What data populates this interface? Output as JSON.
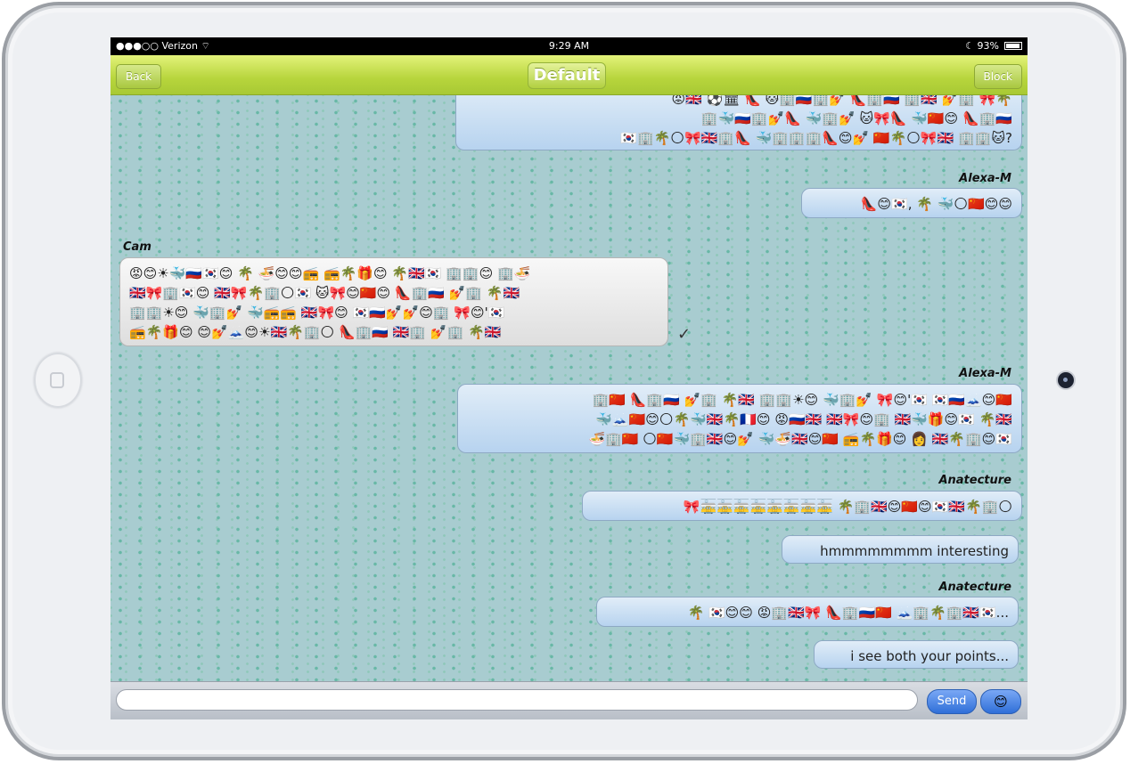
{
  "status_bar": {
    "carrier": "●●●○○ Verizon ⌔",
    "time": "9:29 AM",
    "battery": "☾ 93%"
  },
  "nav": {
    "back_label": "Back",
    "title": "Default",
    "block_label": "Block"
  },
  "messages": [
    {
      "id": "m1",
      "sender": "",
      "side": "right",
      "text": "😡🇬🇧 ⚽🏛 👠 🐱🏢🇷🇺🏢💅 👠🏢🇷🇺 🏢🇬🇧 💅🏢 🎀🌴\n🏢🐳🇷🇺🏢💅👠 🐳🏢💅 🐱🎀👠 🐳🇨🇳😊 👠🏢🇷🇺\n🇰🇷🏢🌴🌕🎀🇬🇧🏢👠 🐳🏢🏢🏢👠😊💅 🇨🇳🌴🌕🎀🇬🇧 🏢🏢🐱?"
    },
    {
      "id": "m2",
      "sender": "Alexa-M",
      "side": "right",
      "text": "👠😊🇰🇷, 🌴 🐳🌕🇨🇳😊😊"
    },
    {
      "id": "m3",
      "sender": "Cam",
      "side": "left",
      "text": "😡😊☀🐳🇷🇺🇰🇷😊 🌴 🍜😊😊📻 📻🌴🎁😊 🌴🇬🇧🇰🇷 🏢🏢😊 🏢🍜\n🇬🇧🎀🏢🇰🇷😊 🇬🇧🎀🌴🏢🌕🇰🇷 🐱🎀😊🇨🇳😊 👠🏢🇷🇺 💅🏢 🌴🇬🇧\n🏢🏢☀😊 🐳🏢💅 🐳📻📻 🇬🇧🎀😊 🇰🇷🇷🇺💅💅😊🏢 🎀😊'🇰🇷\n📻🌴🎁😊 😊💅🗻😊☀🇬🇧🌴🏢🌕 👠🏢🇷🇺 🇬🇧🏢 💅🏢 🌴🇬🇧"
    },
    {
      "id": "m4",
      "sender": "Alexa-M",
      "side": "right",
      "text": "🏢🇨🇳 👠🏢🇷🇺 💅🏢 🌴🇬🇧 🏢🏢☀😊 🐳🏢💅 🎀😊'🇰🇷 🇰🇷🇷🇺🗻😊🇨🇳\n🐳🗻🇨🇳😊🌕🌴🐳🇬🇧🌴🇫🇷😊 😡🇷🇺🇬🇧 🇬🇧🎀😊🏢 🇬🇧🐳🎁😊🇰🇷 🌴🇬🇧\n🍜🏢🇨🇳 🌕🇨🇳🐳🏢🇬🇧😊💅 🐳🍜🇬🇧😊🇨🇳 📻🌴🎁😊 👩 🇬🇧🌴🏢😊🇰🇷"
    },
    {
      "id": "m5",
      "sender": "Anatecture",
      "side": "right",
      "text": "🎀🚋🚋🚋🚋🚋🚋🚋🚋 🌴🏢🇬🇧😊🇨🇳😊🇰🇷🇬🇧🌴🏢🌕"
    },
    {
      "id": "m6",
      "sender": "",
      "side": "right",
      "text": "hmmmmmmmm interesting"
    },
    {
      "id": "m7",
      "sender": "Anatecture",
      "side": "right",
      "text": "🌴 🇰🇷😊😊 😡🏢🇬🇧🎀 👠🏢🇷🇺🇨🇳 🗻🏢🌴🏢🇬🇧🇰🇷..."
    },
    {
      "id": "m8",
      "sender": "",
      "side": "right",
      "text": "i see both your points..."
    }
  ],
  "read_receipt": "✓",
  "composer": {
    "placeholder": "",
    "send_label": "Send",
    "emoji_label": "😊"
  }
}
